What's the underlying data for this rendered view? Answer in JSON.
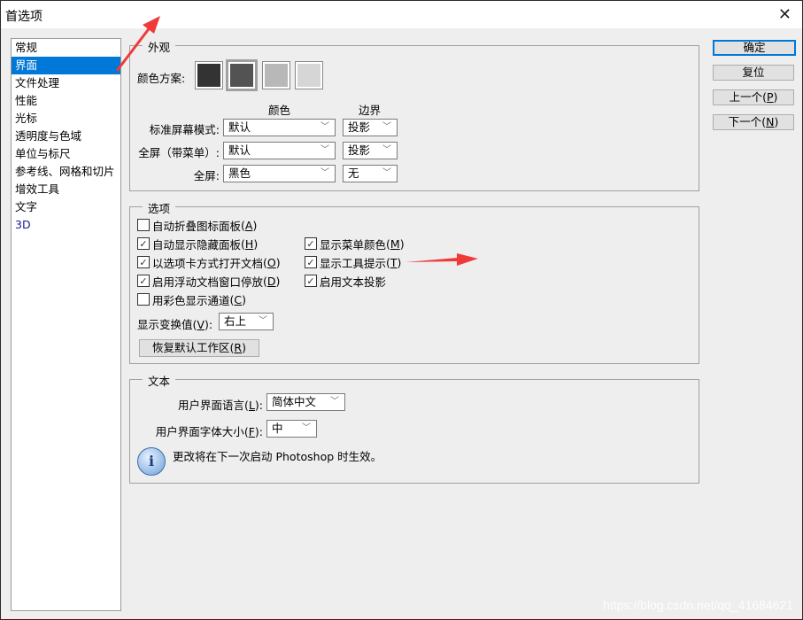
{
  "window": {
    "title": "首选项",
    "close_label": "✕"
  },
  "sidebar": {
    "items": [
      {
        "label": "常规"
      },
      {
        "label": "界面"
      },
      {
        "label": "文件处理"
      },
      {
        "label": "性能"
      },
      {
        "label": "光标"
      },
      {
        "label": "透明度与色域"
      },
      {
        "label": "单位与标尺"
      },
      {
        "label": "参考线、网格和切片"
      },
      {
        "label": "增效工具"
      },
      {
        "label": "文字"
      },
      {
        "label": "3D"
      }
    ],
    "selected": "界面"
  },
  "appearance": {
    "legend": "外观",
    "color_scheme_label": "颜色方案:",
    "swatches": [
      {
        "color": "#333333"
      },
      {
        "color": "#535353"
      },
      {
        "color": "#b8b8b8"
      },
      {
        "color": "#d6d6d6"
      }
    ],
    "col_color": "颜色",
    "col_border": "边界",
    "rows": [
      {
        "label": "标准屏幕模式:",
        "color": "默认",
        "border": "投影"
      },
      {
        "label": "全屏（带菜单）:",
        "color": "默认",
        "border": "投影"
      },
      {
        "label": "全屏:",
        "color": "黑色",
        "border": "无"
      }
    ]
  },
  "options": {
    "legend": "选项",
    "left": [
      {
        "label": "自动折叠图标面板",
        "key": "A",
        "checked": false
      },
      {
        "label": "自动显示隐藏面板",
        "key": "H",
        "checked": true
      },
      {
        "label": "以选项卡方式打开文档",
        "key": "O",
        "checked": true
      },
      {
        "label": "启用浮动文档窗口停放",
        "key": "D",
        "checked": true
      },
      {
        "label": "用彩色显示通道",
        "key": "C",
        "checked": false
      }
    ],
    "right": [
      {
        "label": "显示菜单颜色",
        "key": "M",
        "checked": true
      },
      {
        "label": "显示工具提示",
        "key": "T",
        "checked": true
      },
      {
        "label": "启用文本投影",
        "key": "",
        "checked": true
      }
    ],
    "transform_label": "显示变换值",
    "transform_key": "V",
    "transform_value": "右上",
    "reset_label": "恢复默认工作区",
    "reset_key": "R"
  },
  "text": {
    "legend": "文本",
    "lang_label": "用户界面语言",
    "lang_key": "L",
    "lang_value": "简体中文",
    "size_label": "用户界面字体大小",
    "size_key": "F",
    "size_value": "中",
    "info": "更改将在下一次启动 Photoshop 时生效。"
  },
  "buttons": {
    "ok": "确定",
    "reset": "复位",
    "prev": "上一个",
    "prev_key": "P",
    "next": "下一个",
    "next_key": "N"
  },
  "watermark": "https://blog.csdn.net/qq_41684621"
}
